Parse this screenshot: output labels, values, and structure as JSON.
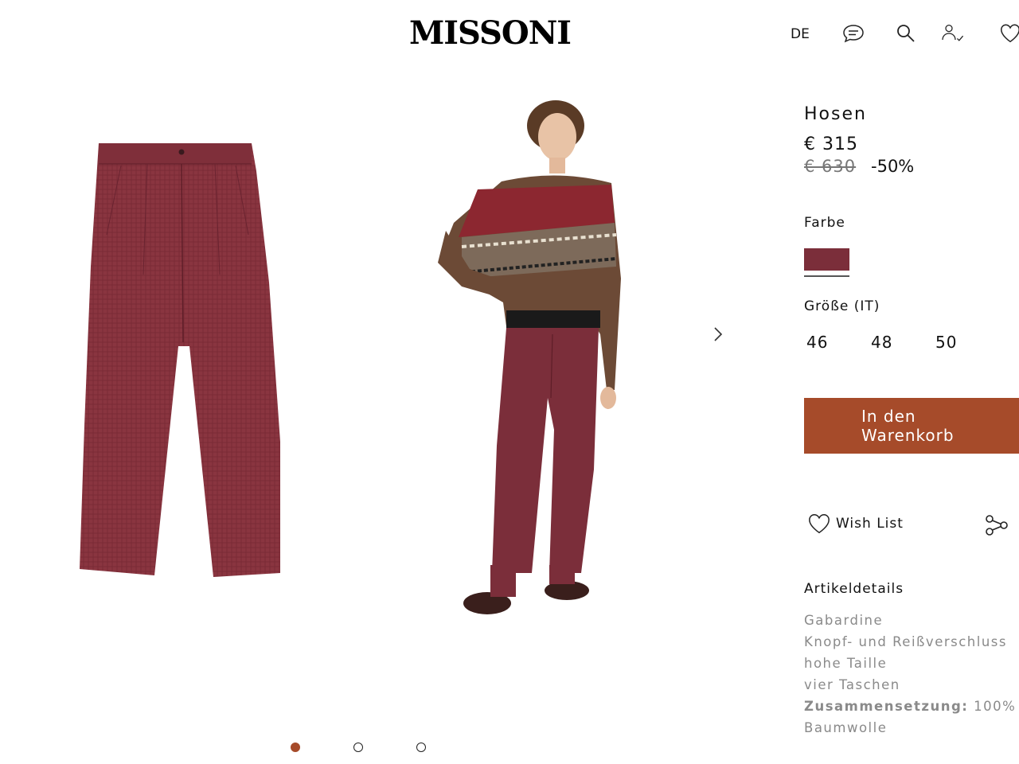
{
  "header": {
    "logo": "MISSONI",
    "language": "DE"
  },
  "gallery": {
    "slide_count": 3,
    "active_slide": 1,
    "images": [
      "flat-lay-trousers",
      "model-wearing-trousers"
    ]
  },
  "product": {
    "title": "Hosen",
    "price": "€ 315",
    "old_price": "€ 630",
    "discount": "-50%",
    "color_label": "Farbe",
    "color_swatch": "#7b2e3a",
    "size_label": "Größe (IT)",
    "sizes": [
      "46",
      "48",
      "50"
    ],
    "cart_button": "In den Warenkorb",
    "wishlist_label": "Wish List"
  },
  "details": {
    "title": "Artikeldetails",
    "lines": [
      "Gabardine",
      "Knopf- und Reißverschluss",
      "hohe Taille",
      "vier Taschen"
    ],
    "composition_label": "Zusammensetzung:",
    "composition_value": "100% Baumwolle"
  },
  "colors": {
    "accent": "#a64b2a",
    "trousers": "#7b2e3a"
  }
}
